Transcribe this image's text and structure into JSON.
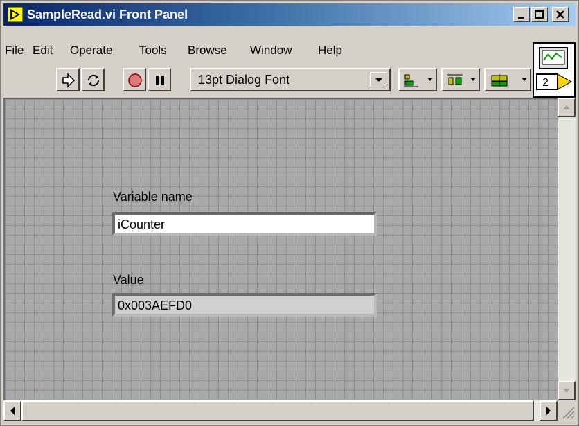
{
  "window": {
    "title": "SampleRead.vi Front Panel"
  },
  "menu": [
    {
      "label": "File"
    },
    {
      "label": "Edit"
    },
    {
      "label": "Operate"
    },
    {
      "label": "Tools"
    },
    {
      "label": "Browse"
    },
    {
      "label": "Window"
    },
    {
      "label": "Help"
    }
  ],
  "toolbar": {
    "font_select": "13pt Dialog Font",
    "connector_number": "2"
  },
  "panel": {
    "variable_label": "Variable name",
    "variable_value": "iCounter",
    "value_label": "Value",
    "value_display": "0x003AEFD0"
  },
  "colors": {
    "title_start": "#0a246a",
    "title_end": "#a6caf0",
    "panel_bg": "#a8a8a8",
    "grid": "#8e8e8e"
  }
}
